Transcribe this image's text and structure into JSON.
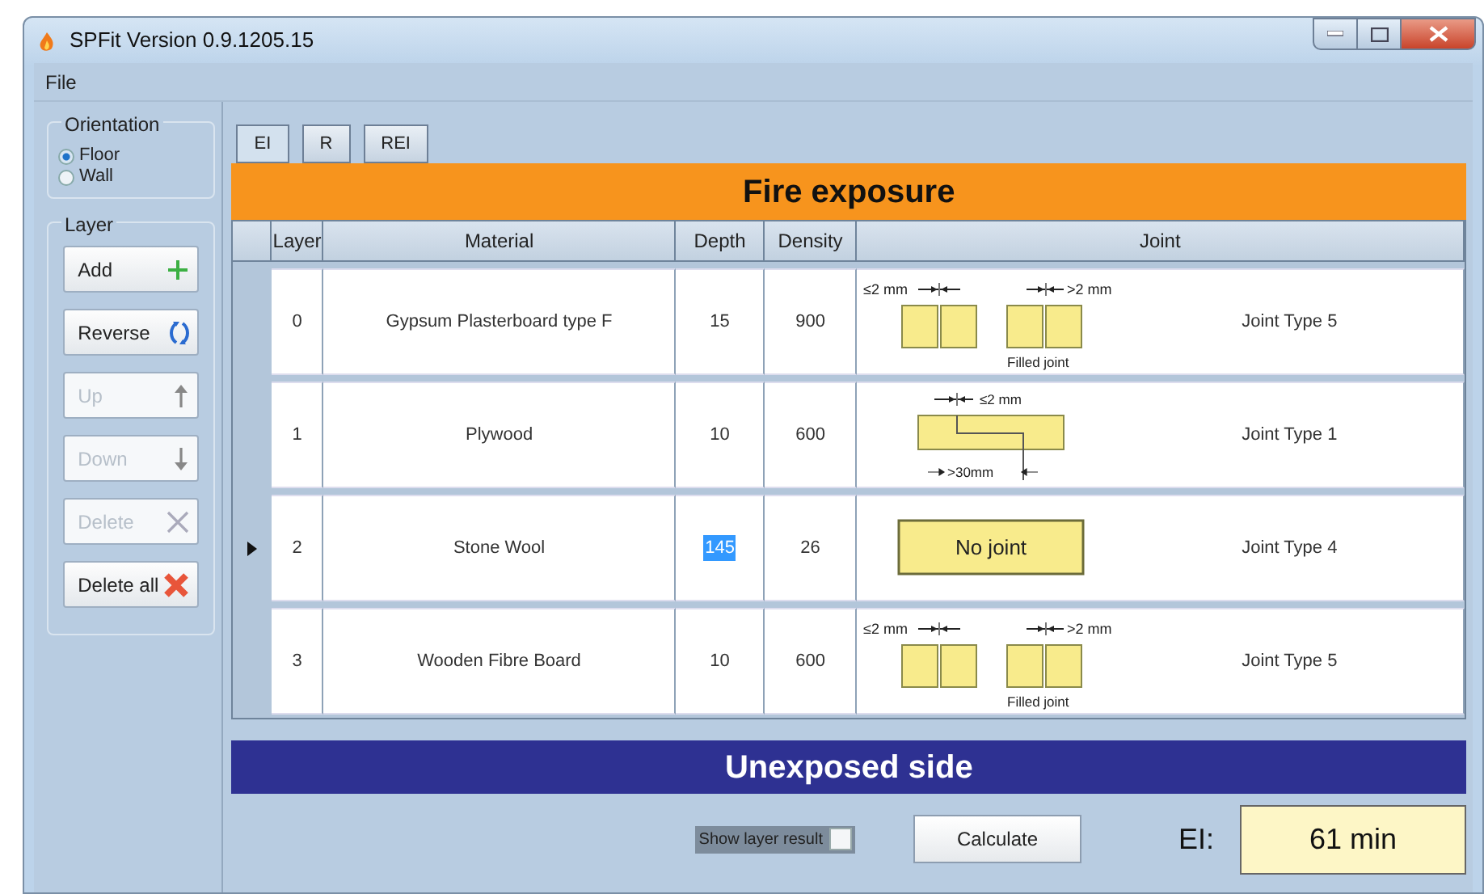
{
  "window": {
    "title": "SPFit Version 0.9.1205.15"
  },
  "menu": [
    "File"
  ],
  "orientation": {
    "label": "Orientation",
    "options": [
      {
        "label": "Floor",
        "selected": true
      },
      {
        "label": "Wall",
        "selected": false
      }
    ]
  },
  "layer_group": {
    "label": "Layer",
    "buttons": [
      {
        "label": "Add",
        "kind": "add",
        "disabled": false
      },
      {
        "label": "Reverse",
        "kind": "reverse",
        "disabled": false
      },
      {
        "label": "Up",
        "kind": "up",
        "disabled": true
      },
      {
        "label": "Down",
        "kind": "down",
        "disabled": true
      },
      {
        "label": "Delete",
        "kind": "delete",
        "disabled": true
      },
      {
        "label": "Delete all",
        "kind": "delete_all",
        "disabled": false
      }
    ]
  },
  "tabs": [
    {
      "label": "EI",
      "selected": true
    },
    {
      "label": "R",
      "selected": false
    },
    {
      "label": "REI",
      "selected": false
    }
  ],
  "top_banner": "Fire exposure",
  "table": {
    "columns": [
      "Layer",
      "Material",
      "Depth",
      "Density",
      "Joint"
    ],
    "rows": [
      {
        "layer": "0",
        "material": "Gypsum Plasterboard type F",
        "depth": "15",
        "density": "900",
        "selected": false,
        "depth_selected": false,
        "joint": {
          "kind": "split",
          "labels": [
            "≤2 mm",
            ">2 mm",
            "Filled joint"
          ]
        },
        "joint_type": "Joint Type 5"
      },
      {
        "layer": "1",
        "material": "Plywood",
        "depth": "10",
        "density": "600",
        "selected": false,
        "depth_selected": false,
        "joint": {
          "kind": "stepped",
          "labels": [
            "≤2 mm",
            ">30mm"
          ]
        },
        "joint_type": "Joint Type 1"
      },
      {
        "layer": "2",
        "material": "Stone Wool",
        "depth": "145",
        "density": "26",
        "selected": true,
        "depth_selected": true,
        "joint": {
          "kind": "none",
          "labels": [
            "No joint"
          ]
        },
        "joint_type": "Joint Type 4"
      },
      {
        "layer": "3",
        "material": "Wooden Fibre Board",
        "depth": "10",
        "density": "600",
        "selected": false,
        "depth_selected": false,
        "joint": {
          "kind": "split",
          "labels": [
            "≤2 mm",
            ">2 mm",
            "Filled joint"
          ]
        },
        "joint_type": "Joint Type 5"
      }
    ]
  },
  "bottom_banner": "Unexposed side",
  "show_layer_result": {
    "label": "Show layer result",
    "checked": false
  },
  "calculate_button": "Calculate",
  "result": {
    "label": "EI:",
    "value": "61 min"
  }
}
